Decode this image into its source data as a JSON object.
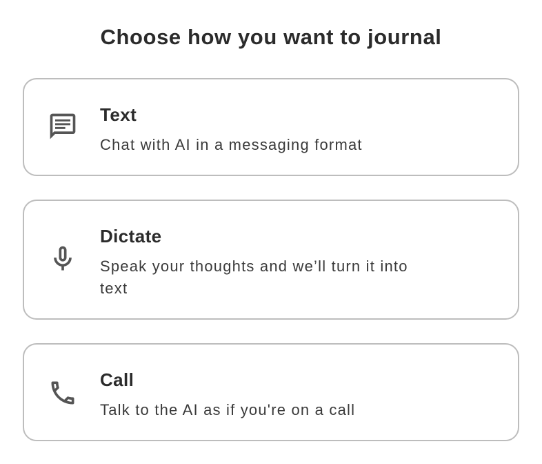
{
  "page": {
    "title": "Choose how you want to journal"
  },
  "options": [
    {
      "icon": "chat-bubble-icon",
      "name": "Text",
      "description": "Chat with AI in a messaging format"
    },
    {
      "icon": "microphone-icon",
      "name": "Dictate",
      "description": "Speak your thoughts and we’ll turn it into text"
    },
    {
      "icon": "phone-icon",
      "name": "Call",
      "description": "Talk to the AI as if you're on a call"
    }
  ],
  "colors": {
    "text": "#2b2b2b",
    "border": "#bdbdbd",
    "icon": "#555555",
    "background": "#ffffff"
  }
}
